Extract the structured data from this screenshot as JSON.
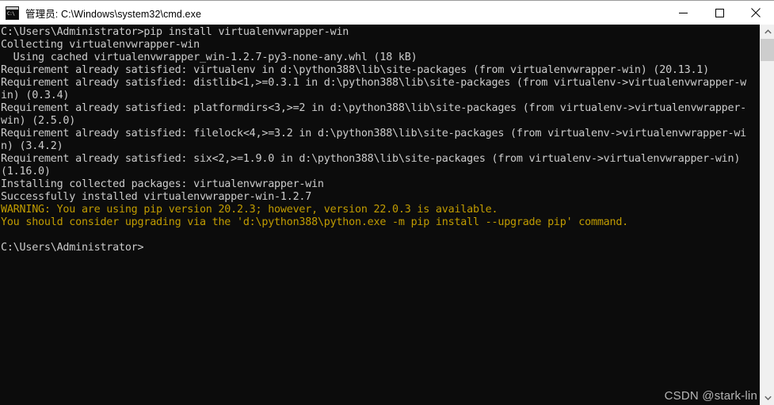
{
  "window": {
    "title": "管理员: C:\\Windows\\system32\\cmd.exe",
    "icon_name": "cmd-exe-icon",
    "icon_glyph": "C:\\",
    "titlebar_bg": "#ffffff",
    "console_bg": "#0c0c0c"
  },
  "controls": {
    "minimize_label": "Minimize",
    "maximize_label": "Maximize",
    "close_label": "Close"
  },
  "console": {
    "foreground": "#cccccc",
    "warning_color": "#c19c00",
    "lines": [
      {
        "text": "C:\\Users\\Administrator>pip install virtualenvwrapper-win",
        "color": "white"
      },
      {
        "text": "Collecting virtualenvwrapper-win",
        "color": "white"
      },
      {
        "text": "  Using cached virtualenvwrapper_win-1.2.7-py3-none-any.whl (18 kB)",
        "color": "white"
      },
      {
        "text": "Requirement already satisfied: virtualenv in d:\\python388\\lib\\site-packages (from virtualenvwrapper-win) (20.13.1)",
        "color": "white"
      },
      {
        "text": "Requirement already satisfied: distlib<1,>=0.3.1 in d:\\python388\\lib\\site-packages (from virtualenv->virtualenvwrapper-w",
        "color": "white"
      },
      {
        "text": "in) (0.3.4)",
        "color": "white"
      },
      {
        "text": "Requirement already satisfied: platformdirs<3,>=2 in d:\\python388\\lib\\site-packages (from virtualenv->virtualenvwrapper-",
        "color": "white"
      },
      {
        "text": "win) (2.5.0)",
        "color": "white"
      },
      {
        "text": "Requirement already satisfied: filelock<4,>=3.2 in d:\\python388\\lib\\site-packages (from virtualenv->virtualenvwrapper-wi",
        "color": "white"
      },
      {
        "text": "n) (3.4.2)",
        "color": "white"
      },
      {
        "text": "Requirement already satisfied: six<2,>=1.9.0 in d:\\python388\\lib\\site-packages (from virtualenv->virtualenvwrapper-win)",
        "color": "white"
      },
      {
        "text": "(1.16.0)",
        "color": "white"
      },
      {
        "text": "Installing collected packages: virtualenvwrapper-win",
        "color": "white"
      },
      {
        "text": "Successfully installed virtualenvwrapper-win-1.2.7",
        "color": "white"
      },
      {
        "text": "WARNING: You are using pip version 20.2.3; however, version 22.0.3 is available.",
        "color": "yellow"
      },
      {
        "text": "You should consider upgrading via the 'd:\\python388\\python.exe -m pip install --upgrade pip' command.",
        "color": "yellow"
      },
      {
        "text": "",
        "color": "white"
      },
      {
        "text": "C:\\Users\\Administrator>",
        "color": "white"
      }
    ]
  },
  "watermark": {
    "text": "CSDN @stark-lin"
  },
  "scrollbar": {
    "up_arrow": "▲",
    "down_arrow": "▼",
    "thumb_position_percent": 0,
    "track_color": "#f0f0f0",
    "thumb_color": "#cdcdcd"
  }
}
